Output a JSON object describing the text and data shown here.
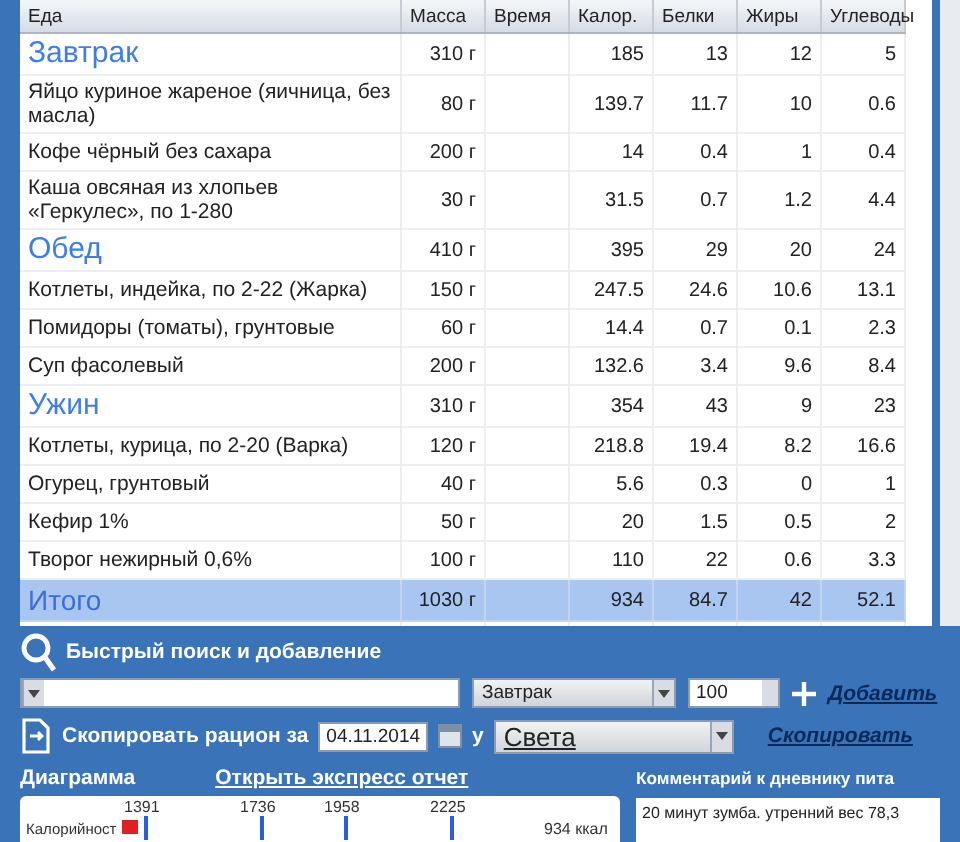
{
  "table": {
    "columns": [
      "Еда",
      "Масса",
      "Время",
      "Калор.",
      "Белки",
      "Жиры",
      "Углеводы"
    ],
    "rows": [
      {
        "kind": "meal",
        "cells": [
          "Завтрак",
          "310 г",
          "",
          "185",
          "13",
          "12",
          "5"
        ]
      },
      {
        "kind": "food",
        "cells": [
          "Яйцо куриное жареное (яичница, без масла)",
          "80 г",
          "",
          "139.7",
          "11.7",
          "10",
          "0.6"
        ]
      },
      {
        "kind": "food",
        "cells": [
          "Кофе чёрный без сахара",
          "200 г",
          "",
          "14",
          "0.4",
          "1",
          "0.4"
        ]
      },
      {
        "kind": "food",
        "cells": [
          "Каша овсяная из хлопьев «Геркулес», по 1-280",
          "30 г",
          "",
          "31.5",
          "0.7",
          "1.2",
          "4.4"
        ]
      },
      {
        "kind": "meal",
        "cells": [
          "Обед",
          "410 г",
          "",
          "395",
          "29",
          "20",
          "24"
        ]
      },
      {
        "kind": "food",
        "cells": [
          "Котлеты, индейка, по 2-22 (Жарка)",
          "150 г",
          "",
          "247.5",
          "24.6",
          "10.6",
          "13.1"
        ]
      },
      {
        "kind": "food",
        "cells": [
          "Помидоры (томаты), грунтовые",
          "60 г",
          "",
          "14.4",
          "0.7",
          "0.1",
          "2.3"
        ]
      },
      {
        "kind": "food",
        "cells": [
          "Суп фасолевый",
          "200 г",
          "",
          "132.6",
          "3.4",
          "9.6",
          "8.4"
        ]
      },
      {
        "kind": "meal",
        "cells": [
          "Ужин",
          "310 г",
          "",
          "354",
          "43",
          "9",
          "23"
        ]
      },
      {
        "kind": "food",
        "cells": [
          "Котлеты, курица, по 2-20 (Варка)",
          "120 г",
          "",
          "218.8",
          "19.4",
          "8.2",
          "16.6"
        ]
      },
      {
        "kind": "food",
        "cells": [
          "Огурец, грунтовый",
          "40 г",
          "",
          "5.6",
          "0.3",
          "0",
          "1"
        ]
      },
      {
        "kind": "food",
        "cells": [
          "Кефир 1%",
          "50 г",
          "",
          "20",
          "1.5",
          "0.5",
          "2"
        ]
      },
      {
        "kind": "food",
        "cells": [
          "Творог нежирный 0,6%",
          "100 г",
          "",
          "110",
          "22",
          "0.6",
          "3.3"
        ]
      },
      {
        "kind": "total",
        "cells": [
          "Итого",
          "1030 г",
          "",
          "934",
          "84.7",
          "42",
          "52.1"
        ]
      }
    ]
  },
  "quick_add": {
    "title": "Быстрый поиск и добавление",
    "meal": "Завтрак",
    "amount": "100",
    "add_link": "Добавить"
  },
  "copy": {
    "label": "Скопировать рацион за",
    "date": "04.11.2014",
    "preposition": "у",
    "person": "Света",
    "link": "Скопировать"
  },
  "diagram": {
    "title": "Диаграмма",
    "report_link": "Открыть экспресс отчет",
    "ticks": [
      "1391",
      "1736",
      "1958",
      "2225"
    ],
    "row_label": "Калорийност",
    "value": "934 ккал"
  },
  "comment": {
    "title": "Комментарий к дневнику пита",
    "text": "20 минут зумба. утренний вес 78,3"
  }
}
